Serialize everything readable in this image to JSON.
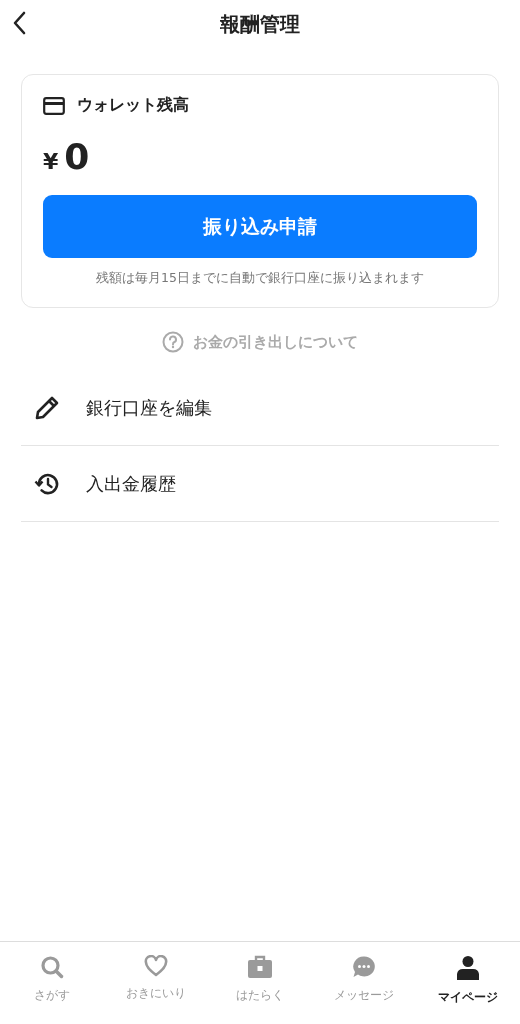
{
  "header": {
    "title": "報酬管理"
  },
  "wallet": {
    "label": "ウォレット残高",
    "currency": "¥",
    "amount": "0",
    "button": "振り込み申請",
    "note": "残額は毎月15日までに自動で銀行口座に振り込まれます"
  },
  "help_link": "お金の引き出しについて",
  "menu": [
    {
      "kind": "edit",
      "label": "銀行口座を編集"
    },
    {
      "kind": "history",
      "label": "入出金履歴"
    }
  ],
  "tabs": [
    {
      "kind": "search",
      "label": "さがす",
      "selected": false
    },
    {
      "kind": "heart",
      "label": "おきにいり",
      "selected": false
    },
    {
      "kind": "work",
      "label": "はたらく",
      "selected": false
    },
    {
      "kind": "chat",
      "label": "メッセージ",
      "selected": false
    },
    {
      "kind": "person",
      "label": "マイページ",
      "selected": true
    }
  ]
}
